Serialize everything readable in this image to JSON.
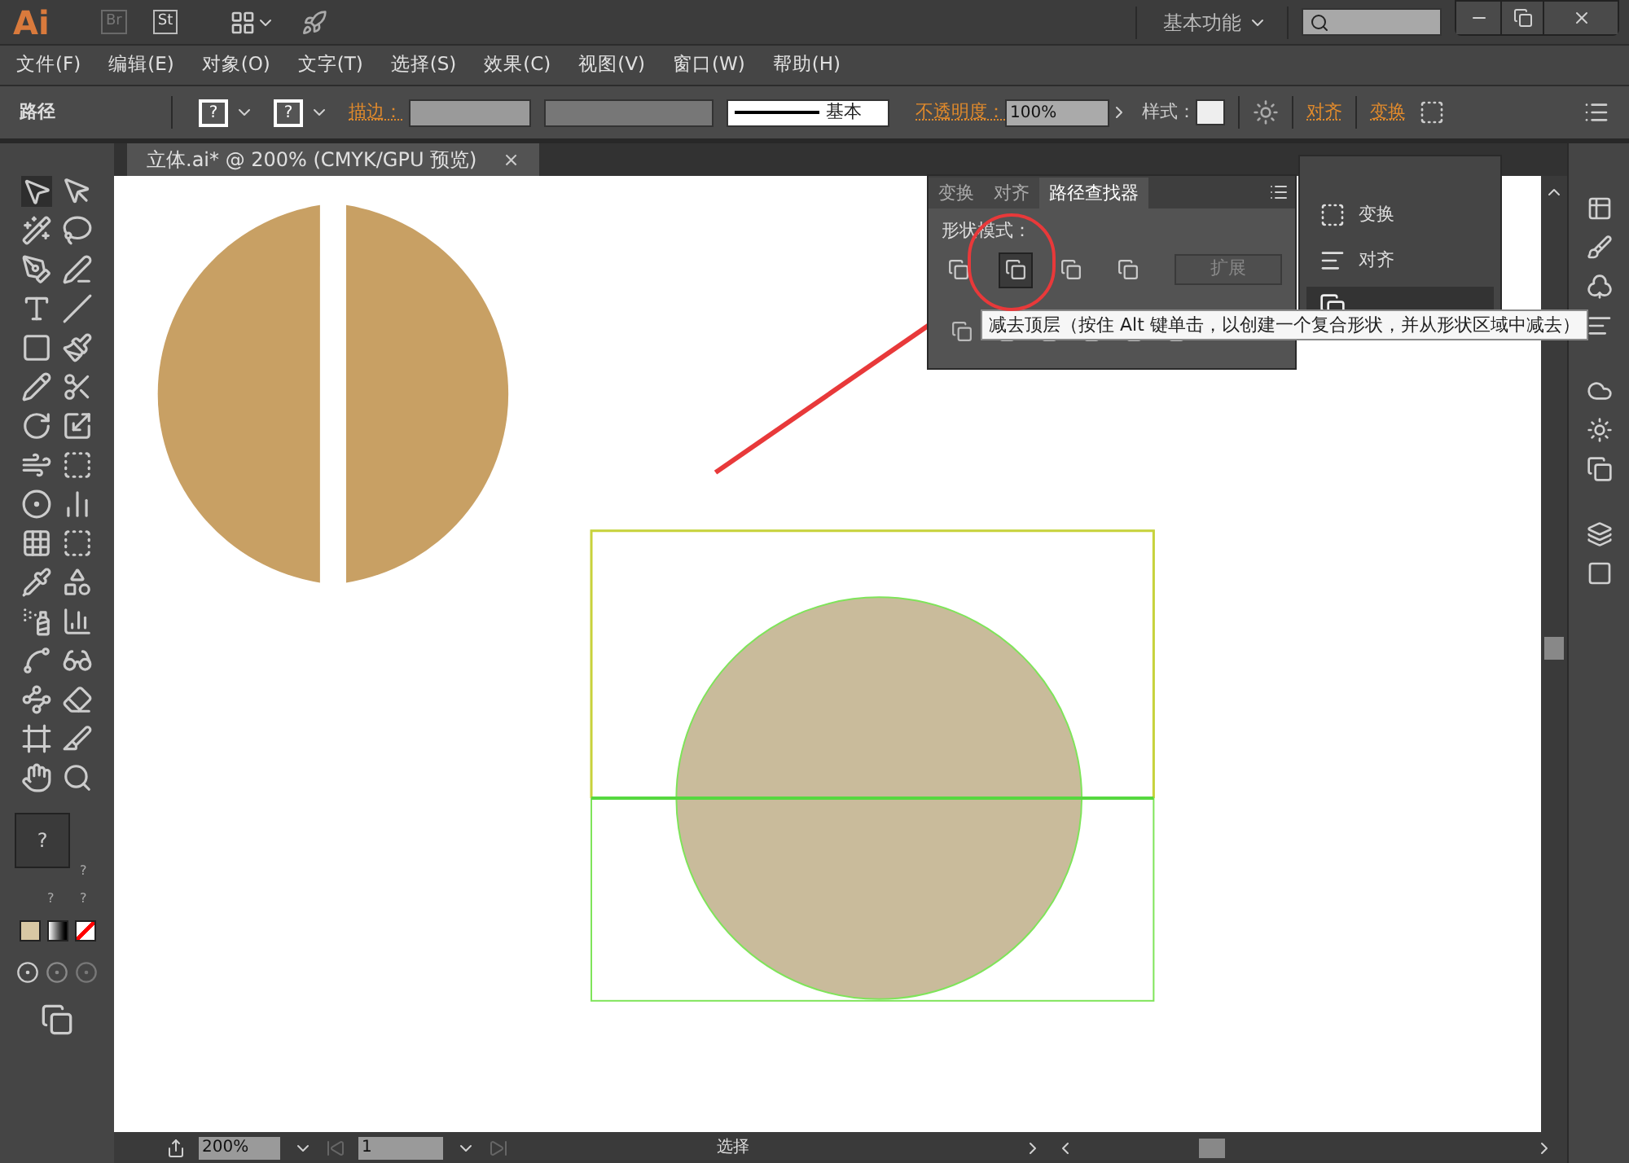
{
  "app": {
    "logo": "Ai",
    "bridge": "Br",
    "stock": "St",
    "workspace": "基本功能"
  },
  "menu": [
    "文件(F)",
    "编辑(E)",
    "对象(O)",
    "文字(T)",
    "选择(S)",
    "效果(C)",
    "视图(V)",
    "窗口(W)",
    "帮助(H)"
  ],
  "control_bar": {
    "selection": "路径",
    "fill": "?",
    "stroke": "?",
    "stroke_label": "描边：",
    "brush": "基本",
    "opacity_label": "不透明度：",
    "opacity": "100%",
    "style_label": "样式：",
    "align": "对齐",
    "transform": "变换"
  },
  "document_tab": {
    "title": "立体.ai* @ 200% (CMYK/GPU 预览)",
    "close": "×"
  },
  "toolbox": {
    "fill": "?",
    "stroke_marks": [
      "?",
      "?",
      "?"
    ]
  },
  "pathfinder": {
    "tabs": [
      {
        "label": "变换",
        "selected": false
      },
      {
        "label": "对齐",
        "selected": false
      },
      {
        "label": "路径查找器",
        "selected": true
      }
    ],
    "shape_modes_label": "形状模式：",
    "shape_modes": [
      {
        "hovered": false
      },
      {
        "hovered": true
      },
      {
        "hovered": false
      },
      {
        "hovered": false
      }
    ],
    "expand_button": "扩展"
  },
  "dock_panel": {
    "items": [
      {
        "label": "变换",
        "selected": false
      },
      {
        "label": "对齐",
        "selected": false
      },
      {
        "selected": true
      }
    ]
  },
  "tooltip": "减去顶层（按住 Alt 键单击，以创建一个复合形状，并从形状区域中减去）",
  "status_bar": {
    "zoom": "200%",
    "page": "1",
    "tool": "选择"
  }
}
